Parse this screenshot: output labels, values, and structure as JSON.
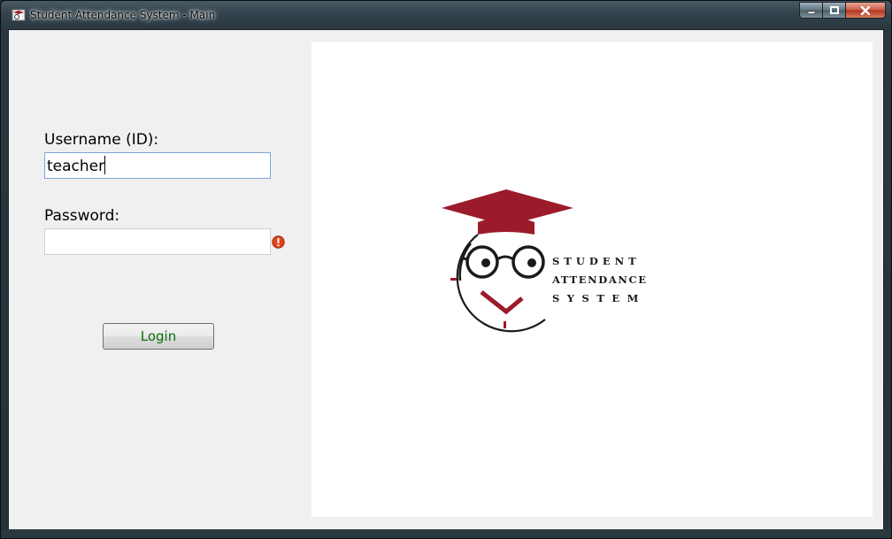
{
  "window": {
    "title": "Student Attendance System - Main"
  },
  "form": {
    "username_label": "Username (ID):",
    "username_value": "teacher",
    "password_label": "Password:",
    "password_value": "",
    "login_label": "Login"
  },
  "logo": {
    "line1": "STUDENT",
    "line2": "ATTENDANCE",
    "line3": "SYSTEM"
  },
  "colors": {
    "accent": "#9b1b2a",
    "login_text": "#0a6e0a"
  },
  "icons": {
    "error": "error-icon",
    "minimize": "minimize-icon",
    "maximize": "maximize-icon",
    "close": "close-icon"
  }
}
